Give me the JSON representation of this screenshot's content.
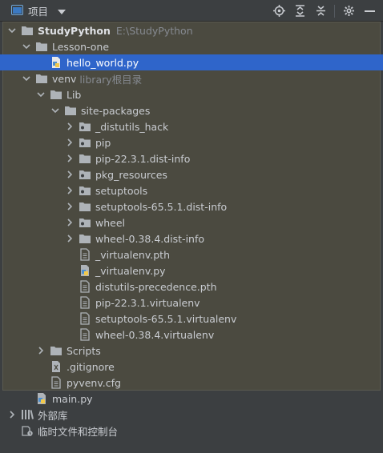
{
  "toolbar": {
    "title": "项目",
    "buttons": [
      "locate-icon",
      "expand-all-icon",
      "collapse-all-icon",
      "settings-icon",
      "hide-icon"
    ]
  },
  "tree": [
    {
      "label": "StudyPython",
      "hint": "E:\\StudyPython",
      "bold": true,
      "expanded": true
    },
    {
      "label": "Lesson-one",
      "expanded": true
    },
    {
      "label": "hello_world.py",
      "selected": true
    },
    {
      "label": "venv",
      "hint": "library根目录",
      "expanded": true
    },
    {
      "label": "Lib",
      "expanded": true
    },
    {
      "label": "site-packages",
      "expanded": true
    },
    {
      "label": "_distutils_hack",
      "expanded": false
    },
    {
      "label": "pip",
      "expanded": false
    },
    {
      "label": "pip-22.3.1.dist-info",
      "expanded": false
    },
    {
      "label": "pkg_resources",
      "expanded": false
    },
    {
      "label": "setuptools",
      "expanded": false
    },
    {
      "label": "setuptools-65.5.1.dist-info",
      "expanded": false
    },
    {
      "label": "wheel",
      "expanded": false
    },
    {
      "label": "wheel-0.38.4.dist-info",
      "expanded": false
    },
    {
      "label": "_virtualenv.pth"
    },
    {
      "label": "_virtualenv.py"
    },
    {
      "label": "distutils-precedence.pth"
    },
    {
      "label": "pip-22.3.1.virtualenv"
    },
    {
      "label": "setuptools-65.5.1.virtualenv"
    },
    {
      "label": "wheel-0.38.4.virtualenv"
    },
    {
      "label": "Scripts",
      "expanded": false
    },
    {
      "label": ".gitignore"
    },
    {
      "label": "pyvenv.cfg"
    },
    {
      "label": "main.py"
    },
    {
      "label": "外部库",
      "expanded": false
    },
    {
      "label": "临时文件和控制台"
    }
  ],
  "colors": {
    "selection": "#2f65ca",
    "tree_background": "#4b4a40",
    "folder": "#aeb3b8",
    "python_blue": "#4d8fcf",
    "python_yellow": "#f2c94c"
  }
}
